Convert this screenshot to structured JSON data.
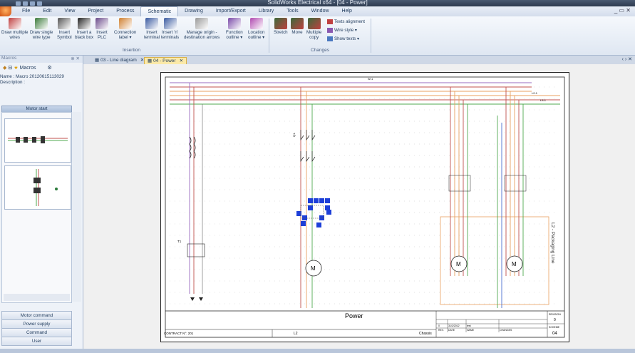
{
  "window": {
    "title": "SolidWorks Electrical x64 - [04 - Power]"
  },
  "menu": {
    "tabs": [
      "File",
      "Edit",
      "View",
      "Project",
      "Process",
      "Schematic",
      "Drawing",
      "Import/Export",
      "Library",
      "Tools",
      "Window",
      "Help"
    ],
    "active": "Schematic"
  },
  "ribbon": {
    "insertion": {
      "label": "Insertion",
      "buttons": [
        {
          "l1": "Draw multiple",
          "l2": "wires"
        },
        {
          "l1": "Draw single",
          "l2": "wire type"
        },
        {
          "l1": "Insert",
          "l2": "Symbol"
        },
        {
          "l1": "Insert a",
          "l2": "black box"
        },
        {
          "l1": "Insert",
          "l2": "PLC"
        },
        {
          "l1": "Connection",
          "l2": "label ▾"
        },
        {
          "l1": "Insert",
          "l2": "terminal"
        },
        {
          "l1": "Insert 'n'",
          "l2": "terminals"
        },
        {
          "l1": "Manage origin -",
          "l2": "destination arrows"
        },
        {
          "l1": "Function",
          "l2": "outline ▾"
        },
        {
          "l1": "Location",
          "l2": "outline ▾"
        }
      ]
    },
    "changes": {
      "label": "Changes",
      "buttons": [
        {
          "l1": "Stretch",
          "l2": ""
        },
        {
          "l1": "Move",
          "l2": ""
        },
        {
          "l1": "Multiple",
          "l2": "copy"
        }
      ],
      "small": [
        "Texts alignment",
        "Wire style ▾",
        "Show texts ▾"
      ]
    }
  },
  "left_panel": {
    "header": "Macros",
    "tool_label": "Macros",
    "name_line": "Name : Macro 20120615113029",
    "description_line": "Description :",
    "group": "Motor start",
    "categories": [
      "Motor command",
      "Power supply",
      "Command",
      "User"
    ]
  },
  "doc_tabs": [
    {
      "label": "03 - Line diagram",
      "selected": false
    },
    {
      "label": "04 - Power",
      "selected": true
    }
  ],
  "sheet": {
    "title": "Power",
    "contract": "CONTRACT N°: 201",
    "location": "L2",
    "chassis": "Chassis",
    "revision_label": "REVISION",
    "revision_value": "0",
    "scheme_label": "SCHEME",
    "scheme_value": "04",
    "rev_headers": [
      "REV.",
      "DATE",
      "NAME",
      "CHANGES"
    ],
    "rev_row": [
      "0",
      "31/2/2012",
      "test",
      ""
    ],
    "function_outline_label": "L2 - Packaging Line",
    "motor_label": "M",
    "wire_labels": [
      "W-1",
      "L2-1",
      "L3-1"
    ],
    "transformer_label": "T1",
    "colors": {
      "wire_red": "#c0504d",
      "wire_orange": "#e8a060",
      "wire_green": "#4fa84f",
      "wire_purple": "#9a6cc0",
      "wire_blue": "#4a6fd0",
      "selection": "#1d3fd8"
    }
  }
}
